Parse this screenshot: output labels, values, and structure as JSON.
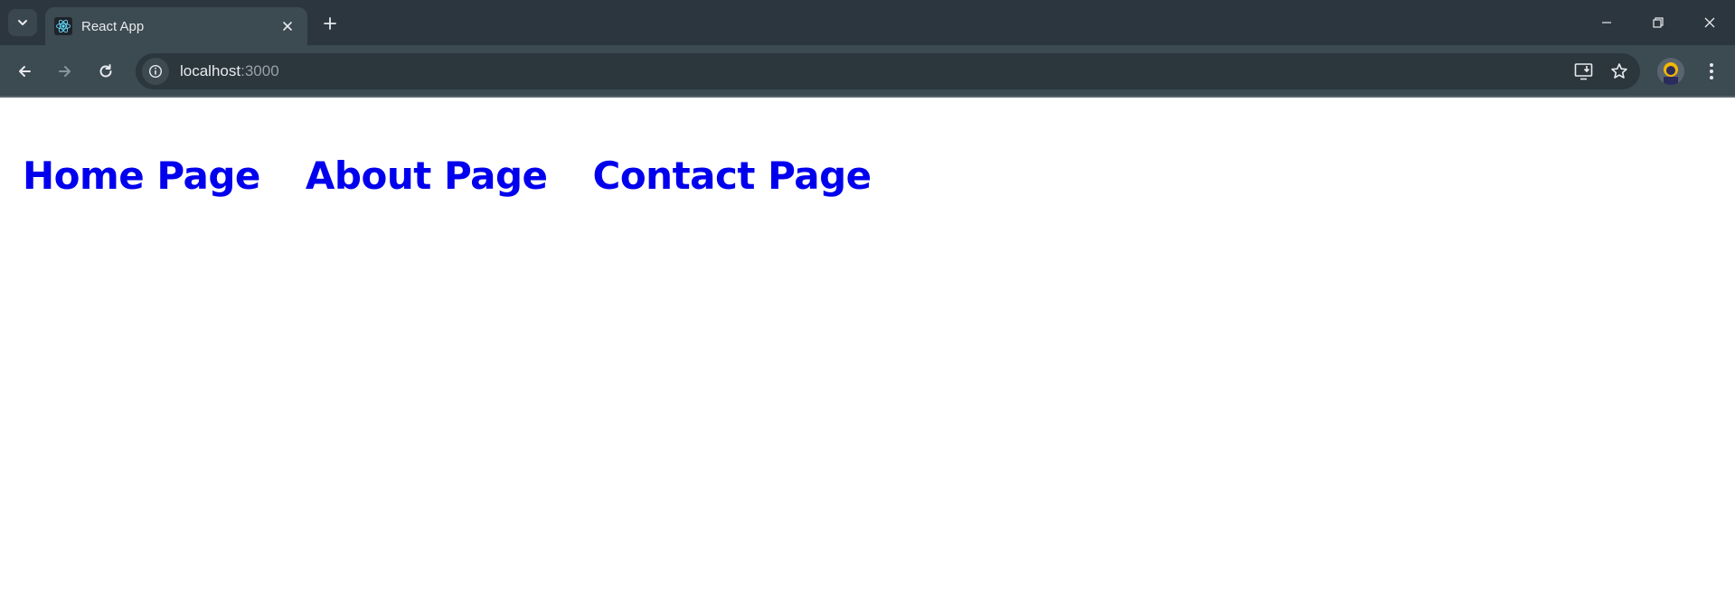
{
  "browser": {
    "tab": {
      "title": "React App",
      "favicon": "react-logo-icon"
    },
    "address_bar": {
      "host": "localhost",
      "port": ":3000"
    },
    "colors": {
      "tabstrip": "#2c363f",
      "toolbar": "#3c4a52",
      "omnibox": "#2b363d",
      "react_blue": "#61dafb"
    }
  },
  "page": {
    "links": [
      {
        "label": "Home Page"
      },
      {
        "label": "About Page"
      },
      {
        "label": "Contact Page"
      }
    ],
    "link_color": "#0000ee"
  }
}
